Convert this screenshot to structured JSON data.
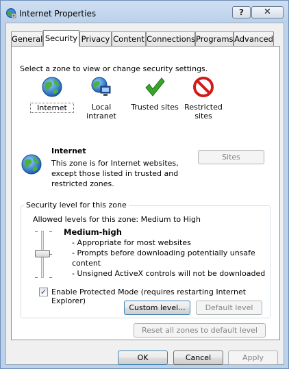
{
  "window": {
    "title": "Internet Properties",
    "help_label": "?",
    "close_label": "✕"
  },
  "tabs": [
    {
      "label": "General"
    },
    {
      "label": "Security",
      "active": true
    },
    {
      "label": "Privacy"
    },
    {
      "label": "Content"
    },
    {
      "label": "Connections"
    },
    {
      "label": "Programs"
    },
    {
      "label": "Advanced"
    }
  ],
  "zones": {
    "instruction": "Select a zone to view or change security settings.",
    "items": [
      {
        "label": "Internet",
        "icon": "globe-icon",
        "selected": true
      },
      {
        "label": "Local intranet",
        "icon": "intranet-icon"
      },
      {
        "label": "Trusted sites",
        "icon": "checkmark-icon"
      },
      {
        "label": "Restricted sites",
        "icon": "restricted-icon"
      }
    ]
  },
  "zone_info": {
    "title": "Internet",
    "description_lines": [
      "This zone is for Internet websites,",
      "except those listed in trusted and",
      "restricted zones."
    ],
    "sites_button": "Sites"
  },
  "security_level": {
    "group_label": "Security level for this zone",
    "allowed": "Allowed levels for this zone: Medium to High",
    "level_name": "Medium-high",
    "details": [
      "- Appropriate for most websites",
      "- Prompts before downloading potentially unsafe",
      "content",
      "- Unsigned ActiveX controls will not be downloaded"
    ],
    "protected_mode_label": "Enable Protected Mode (requires restarting Internet Explorer)",
    "protected_mode_checked": true,
    "custom_level_button": "Custom level...",
    "default_level_button": "Default level"
  },
  "reset_all_button": "Reset all zones to default level",
  "footer": {
    "ok": "OK",
    "cancel": "Cancel",
    "apply": "Apply"
  },
  "colors": {
    "titlebar": "#cfdff2",
    "panel": "#ffffff",
    "restricted_red": "#d11a1a",
    "trusted_green": "#3aa52b"
  }
}
